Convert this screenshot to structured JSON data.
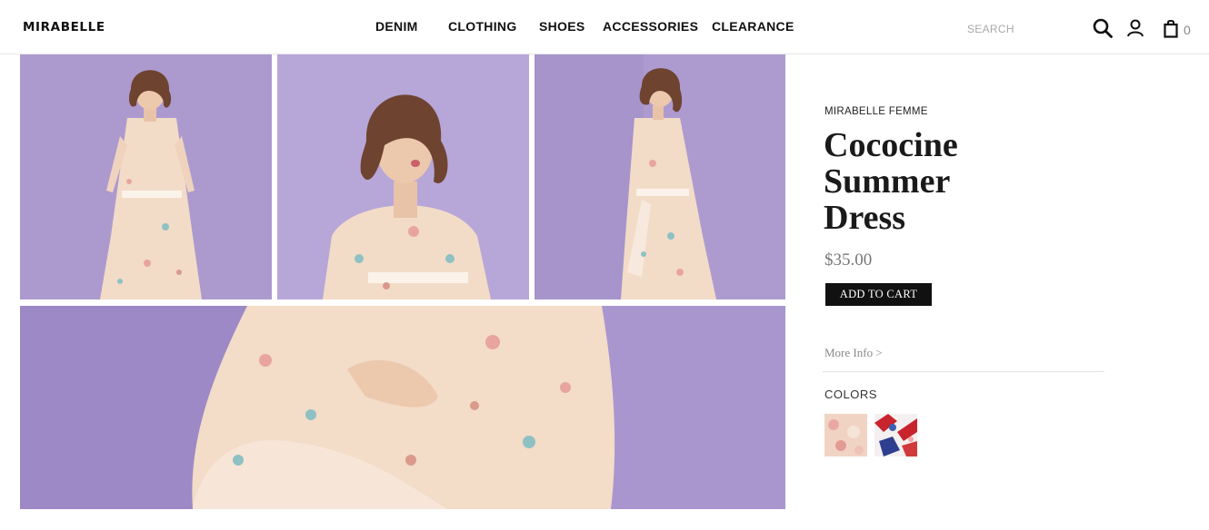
{
  "header": {
    "logo": "MIRABELLE",
    "nav": [
      "DENIM",
      "CLOTHING",
      "SHOES",
      "ACCESSORIES",
      "CLEARANCE"
    ],
    "search_placeholder": "SEARCH",
    "cart_count": "0",
    "icons": [
      "search-icon",
      "user-icon",
      "bag-icon"
    ]
  },
  "product": {
    "brand": "MIRABELLE FEMME",
    "title_lines": [
      "Cococine",
      "Summer",
      "Dress"
    ],
    "price": "$35.00",
    "add_to_cart": "ADD TO CART",
    "more_info": "More Info >",
    "colors_label": "COLORS",
    "swatches": [
      "blush-floral",
      "red-blue-print"
    ]
  },
  "colors": {
    "background": "#b3a2d3",
    "dress": "#f3dcc8",
    "button": "#111111",
    "price": "#777777"
  }
}
